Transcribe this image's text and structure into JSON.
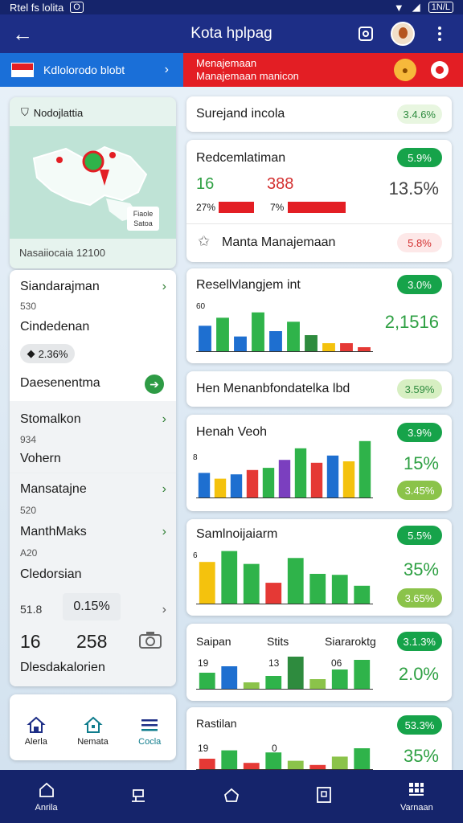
{
  "status": {
    "left": "Rtel fs lolita",
    "badge": "O",
    "right": "1N/L"
  },
  "appbar": {
    "title": "Kota hplpag",
    "back_icon": "arrow-left-icon"
  },
  "banner": {
    "left_text": "Kdlolorodo blobt",
    "right_line1": "Menajemaan",
    "right_line2": "Manajemaan manicon",
    "colors": {
      "blue": "#1a6fd8",
      "red": "#e31e24"
    }
  },
  "left": {
    "map": {
      "title": "Nodojlattia",
      "legend_line1": "Fiaole",
      "legend_line2": "Satoa",
      "footer": "Nasaiiocaia 12100"
    },
    "items": [
      {
        "label": "Siandarajman",
        "sub": "530"
      },
      {
        "label": "Cindedenan",
        "pill": "2.36%"
      },
      {
        "label": "Daesenentma"
      },
      {
        "label": "Stomalkon",
        "sub": "934"
      },
      {
        "label": "Vohern"
      },
      {
        "label": "Mansatajne",
        "sub": "520"
      },
      {
        "label": "ManthMaks",
        "sub": "A20"
      },
      {
        "label": "Cledorsian"
      }
    ],
    "value_row": {
      "left": "51.8",
      "pill": "0.15%"
    },
    "numbers": {
      "a": "16",
      "b": "258"
    },
    "footer_label": "Dlesdakalorien",
    "tabs": [
      {
        "label": "Alerla",
        "icon": "home-icon"
      },
      {
        "label": "Nemata",
        "icon": "house-icon"
      },
      {
        "label": "Cocla",
        "icon": "menu-icon"
      }
    ]
  },
  "right": {
    "card1": {
      "title": "Surejand incola",
      "badge": "3.4.6%"
    },
    "card2": {
      "title": "Redcemlatiman",
      "badge": "5.9%",
      "num_a": "16",
      "num_b": "388",
      "pct": "13.5%",
      "bar_a_label": "27%",
      "bar_b_label": "7%",
      "footer_title": "Manta Manajemaan",
      "footer_badge": "5.8%"
    },
    "card3": {
      "title": "Resellvlangjem int",
      "badge": "3.0%",
      "axis": "60",
      "value": "2,1516"
    },
    "card4": {
      "title": "Hen Menanbfondatelka lbd",
      "badge": "3.59%"
    },
    "card5": {
      "title": "Henah Veoh",
      "badge": "3.9%",
      "axis": "8",
      "pct": "15%",
      "sub_badge": "3.45%"
    },
    "card6": {
      "title": "Samlnoijaiarm",
      "badge": "5.5%",
      "axis": "6",
      "pct": "35%",
      "sub_badge": "3.65%"
    },
    "card7": {
      "title": "Saipan",
      "col2": "Stits",
      "col3": "Siararoktg",
      "badge": "3.1.3%",
      "g1": "19",
      "g2": "13",
      "g3": "06",
      "pct": "2.0%"
    },
    "card8": {
      "title": "Rastilan",
      "badge": "53.3%",
      "g1": "19",
      "g2": "0",
      "pct": "35%"
    }
  },
  "chart_data": [
    {
      "type": "bar",
      "title": "Resellvlangjem int",
      "ylim": [
        0,
        60
      ],
      "values": [
        38,
        50,
        22,
        58,
        30,
        44,
        24,
        12,
        12,
        6
      ],
      "colors": [
        "#1e6fd0",
        "#2fb34a",
        "#1e6fd0",
        "#2fb34a",
        "#1e6fd0",
        "#2fb34a",
        "#2e8b3e",
        "#f4c20d",
        "#e53935",
        "#e53935"
      ]
    },
    {
      "type": "bar",
      "title": "Henah Veoh",
      "ylim": [
        0,
        8
      ],
      "values": [
        3.4,
        2.6,
        3.2,
        3.8,
        4.1,
        5.2,
        6.8,
        4.8,
        5.8,
        5.0,
        7.8
      ],
      "colors": [
        "#1e6fd0",
        "#f4c20d",
        "#1e6fd0",
        "#e53935",
        "#2fb34a",
        "#7b3fbf",
        "#2fb34a",
        "#e53935",
        "#1e6fd0",
        "#f4c20d",
        "#2fb34a"
      ]
    },
    {
      "type": "bar",
      "title": "Samlnoijaiarm",
      "ylim": [
        0,
        6
      ],
      "values": [
        4.2,
        5.3,
        4.0,
        2.1,
        4.6,
        3.0,
        2.9,
        1.8
      ],
      "colors": [
        "#f4c20d",
        "#2fb34a",
        "#2fb34a",
        "#e53935",
        "#2fb34a",
        "#2fb34a",
        "#2fb34a",
        "#2fb34a"
      ]
    },
    {
      "type": "bar",
      "title": "Saipan",
      "values": [
        10,
        14,
        4,
        8,
        20,
        6,
        12,
        18
      ],
      "colors": [
        "#2fb34a",
        "#1e6fd0",
        "#8bc34a",
        "#2fb34a",
        "#2e8b3e",
        "#8bc34a",
        "#2fb34a",
        "#2fb34a"
      ]
    },
    {
      "type": "bar",
      "title": "Rastilan",
      "values": [
        10,
        18,
        6,
        16,
        8,
        4,
        12,
        20
      ],
      "colors": [
        "#e53935",
        "#2fb34a",
        "#e53935",
        "#2fb34a",
        "#8bc34a",
        "#e53935",
        "#8bc34a",
        "#2fb34a"
      ]
    }
  ],
  "navbar": [
    {
      "label": "Anrila",
      "icon": "home-icon"
    },
    {
      "label": "",
      "icon": "flag-icon"
    },
    {
      "label": "",
      "icon": "house-icon"
    },
    {
      "label": "",
      "icon": "list-icon"
    },
    {
      "label": "Varnaan",
      "icon": "grid-icon"
    }
  ]
}
